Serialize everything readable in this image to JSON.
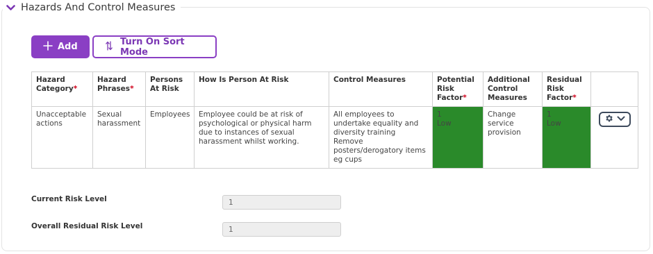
{
  "section": {
    "title": "Hazards And Control Measures",
    "chevron_icon": "chevron-down-icon",
    "accent_color": "#8a3fc4"
  },
  "toolbar": {
    "add_label": "Add",
    "sort_label": "Turn On Sort Mode"
  },
  "table": {
    "headers": {
      "hazard_category": "Hazard Category",
      "hazard_phrases": "Hazard Phrases",
      "persons_at_risk": "Persons At Risk",
      "how_at_risk": "How Is Person At Risk",
      "control_measures": "Control Measures",
      "potential_risk": "Potential Risk Factor",
      "additional_controls": "Additional Control Measures",
      "residual_risk": "Residual Risk Factor"
    },
    "required_marker": "*",
    "rows": [
      {
        "hazard_category": "Unacceptable actions",
        "hazard_phrases": "Sexual harassment",
        "persons_at_risk": "Employees",
        "how_at_risk": "Employee could be at risk of psychological or physical harm due to instances of sexual harassment whilst working.",
        "control_measures_line1": "All employees to undertake equality and diversity training",
        "control_measures_line2": "Remove posters/derogatory items eg cups",
        "potential_risk_value": "1",
        "potential_risk_level": "Low",
        "additional_controls": "Change service provision",
        "residual_risk_value": "1",
        "residual_risk_level": "Low",
        "risk_color": "#2a8a2a"
      }
    ]
  },
  "fields": {
    "current_risk_label": "Current Risk Level",
    "current_risk_value": "1",
    "overall_residual_label": "Overall Residual Risk Level",
    "overall_residual_value": "1"
  }
}
